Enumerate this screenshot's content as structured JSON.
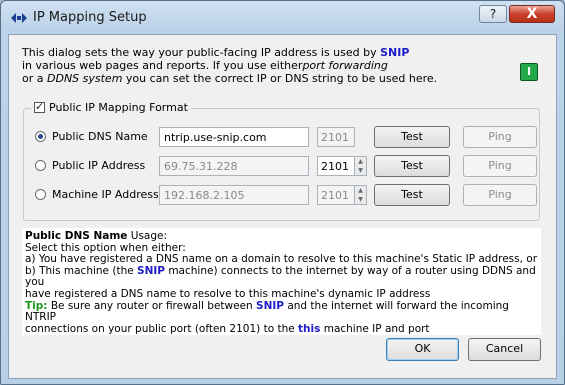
{
  "window": {
    "title": "IP Mapping Setup",
    "help_label": "?",
    "close_label": "X"
  },
  "intro": {
    "l1a": "This dialog sets the way your public-facing IP address is used by ",
    "snip": "SNIP",
    "l2a": "in various web pages and reports.  If you use either",
    "l2b": "port forwarding",
    "l3a": "or a ",
    "l3b": "DDNS system",
    "l3c": " you can set the correct IP or DNS string to be used here."
  },
  "status_light": "I",
  "group": {
    "label": "Public IP Mapping Format",
    "checked": true
  },
  "rows": [
    {
      "label": "Public DNS Name",
      "value": "ntrip.use-snip.com",
      "port": "2101",
      "test": "Test",
      "ping": "Ping",
      "selected": true
    },
    {
      "label": "Public IP Address",
      "value": "69.75.31.228",
      "port": "2101",
      "test": "Test",
      "ping": "Ping",
      "selected": false
    },
    {
      "label": "Machine IP Address",
      "value": "192.168.2.105",
      "port": "2101",
      "test": "Test",
      "ping": "Ping",
      "selected": false
    }
  ],
  "desc": {
    "title": "Public DNS Name",
    "title_suffix": " Usage:",
    "l1": "Select this option when either:",
    "l2": "a) You have registered a DNS name on a domain to resolve to this machine's Static IP address, or",
    "l3a": "b) This machine (the ",
    "l3b": "SNIP",
    "l3c": " machine) connects to the internet by way of a router using DDNS and you",
    "l4": "have registered a DNS name to resolve to this machine's dynamic IP address",
    "tip": "Tip:",
    "l5a": " Be sure any router or firewall between ",
    "l5b": "SNIP",
    "l5c": " and the internet will forward the incoming NTRIP",
    "l6a": "connections on your public port (often 2101) to the ",
    "l6b": "this",
    "l6c": " machine IP and port"
  },
  "footer": {
    "ok": "OK",
    "cancel": "Cancel"
  }
}
